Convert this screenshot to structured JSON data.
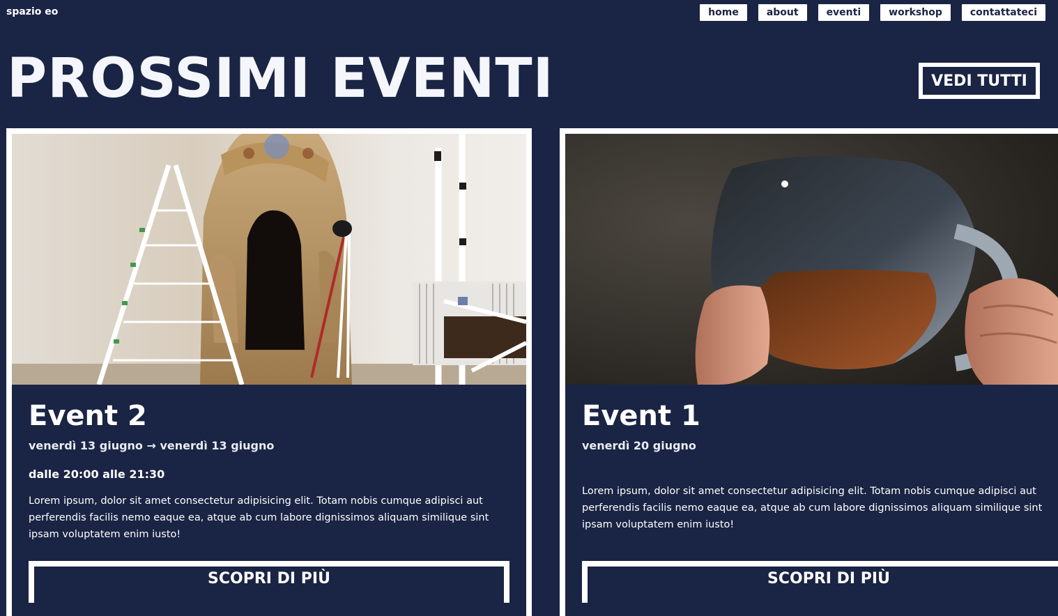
{
  "brand": "spazio eo",
  "nav": [
    "home",
    "about",
    "eventi",
    "workshop",
    "contattateci"
  ],
  "hero": {
    "title": "PROSSIMI EVENTI",
    "see_all": "VEDI TUTTI"
  },
  "events": [
    {
      "title": "Event 2",
      "dates": "venerdì 13 giugno → venerdì 13 giugno",
      "time": "dalle 20:00 alle 21:30",
      "description": "Lorem ipsum, dolor sit amet consectetur adipisicing elit. Totam nobis cumque adipisci aut perferendis facilis nemo eaque ea, atque ab cum labore dignissimos aliquam similique sint ipsam voluptatem enim iusto!",
      "cta": "SCOPRI DI PIÙ"
    },
    {
      "title": "Event 1",
      "dates": "venerdì 20 giugno",
      "description": "Lorem ipsum, dolor sit amet consectetur adipisicing elit. Totam nobis cumque adipisci aut perferendis facilis nemo eaque ea, atque ab cum labore dignissimos aliquam similique sint ipsam voluptatem enim iusto!",
      "cta": "SCOPRI DI PIÙ"
    }
  ],
  "colors": {
    "background": "#1a2444",
    "foreground": "#ffffff"
  }
}
